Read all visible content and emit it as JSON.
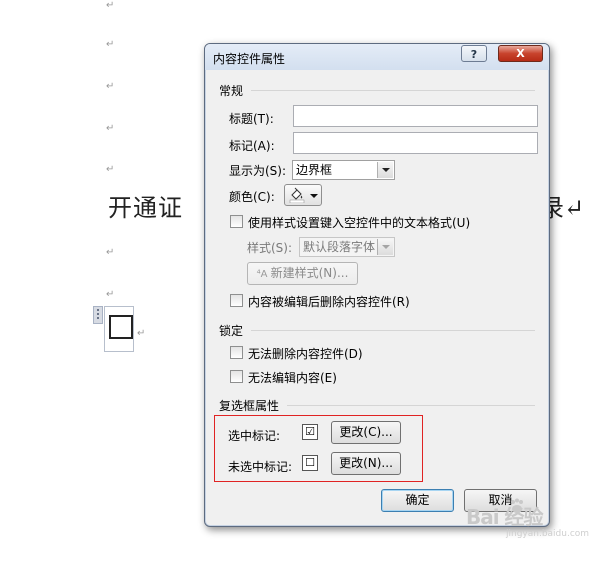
{
  "document": {
    "paragraph_mark": "↵",
    "visible_text_left": "开通证",
    "visible_text_right": "录↵"
  },
  "dialog": {
    "title": "内容控件属性",
    "help_glyph": "?",
    "close_glyph": "X",
    "general": {
      "group_title": "常规",
      "title_label": "标题(T):",
      "title_value": "",
      "tag_label": "标记(A):",
      "tag_value": "",
      "show_as_label": "显示为(S):",
      "show_as_value": "边界框",
      "color_label": "颜色(C):",
      "use_style_label": "使用样式设置键入空控件中的文本格式(U)",
      "style_label": "样式(S):",
      "style_value": "默认段落字体",
      "new_style_button": "新建样式(N)...",
      "remove_after_edit_label": "内容被编辑后删除内容控件(R)"
    },
    "locking": {
      "group_title": "锁定",
      "no_delete_label": "无法删除内容控件(D)",
      "no_edit_label": "无法编辑内容(E)"
    },
    "checkbox_props": {
      "group_title": "复选框属性",
      "checked_label": "选中标记:",
      "checked_symbol": "☑",
      "checked_change_button": "更改(C)...",
      "unchecked_label": "未选中标记:",
      "unchecked_symbol": "☐",
      "unchecked_change_button": "更改(N)..."
    },
    "ok_button": "确定",
    "cancel_button": "取消"
  },
  "watermark": {
    "text": "Bai 经验",
    "sub": "jingyan.baidu.com"
  },
  "colors": {
    "highlight_border": "#e02323",
    "close_button": "#c8432d",
    "dialog_bg": "#f0f0f0"
  }
}
